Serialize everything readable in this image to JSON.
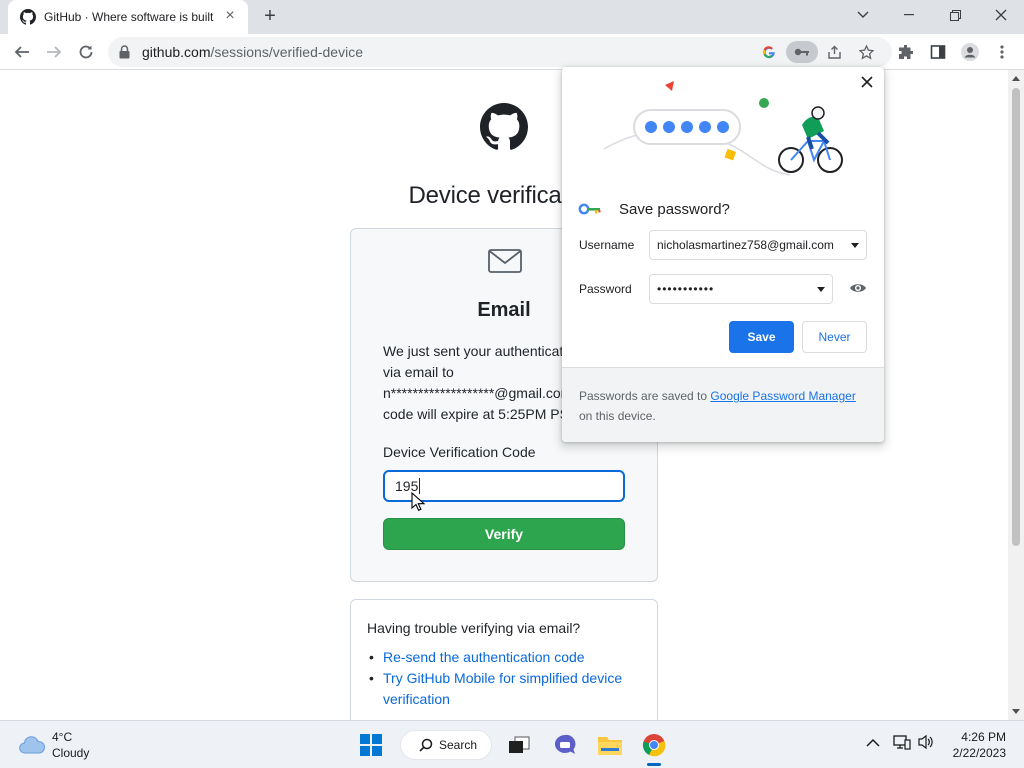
{
  "browser": {
    "tab_title": "GitHub · Where software is built",
    "new_tab_symbol": "+",
    "url_host": "github.com",
    "url_path": "/sessions/verified-device"
  },
  "page": {
    "title": "Device verification",
    "card_heading": "Email",
    "card_body": "We just sent your authentication code via email to n*******************@gmail.com. The code will expire at 5:25PM PST.",
    "code_label": "Device Verification Code",
    "code_value": "195",
    "verify_label": "Verify",
    "help_title": "Having trouble verifying via email?",
    "help_links": [
      "Re-send the authentication code",
      "Try GitHub Mobile for simplified device verification"
    ]
  },
  "password_bubble": {
    "title": "Save password?",
    "username_label": "Username",
    "username_value": "nicholasmartinez758@gmail.com",
    "password_label": "Password",
    "password_value": "•••••••••••",
    "save_label": "Save",
    "never_label": "Never",
    "footer_prefix": "Passwords are saved to ",
    "footer_link": "Google Password Manager",
    "footer_suffix": " on this device."
  },
  "taskbar": {
    "temperature": "4°C",
    "weather": "Cloudy",
    "search_label": "Search",
    "time": "4:26 PM",
    "date": "2/22/2023"
  },
  "colors": {
    "accent_blue": "#1a73e8",
    "github_green": "#2da44e",
    "link_blue": "#0969da"
  }
}
